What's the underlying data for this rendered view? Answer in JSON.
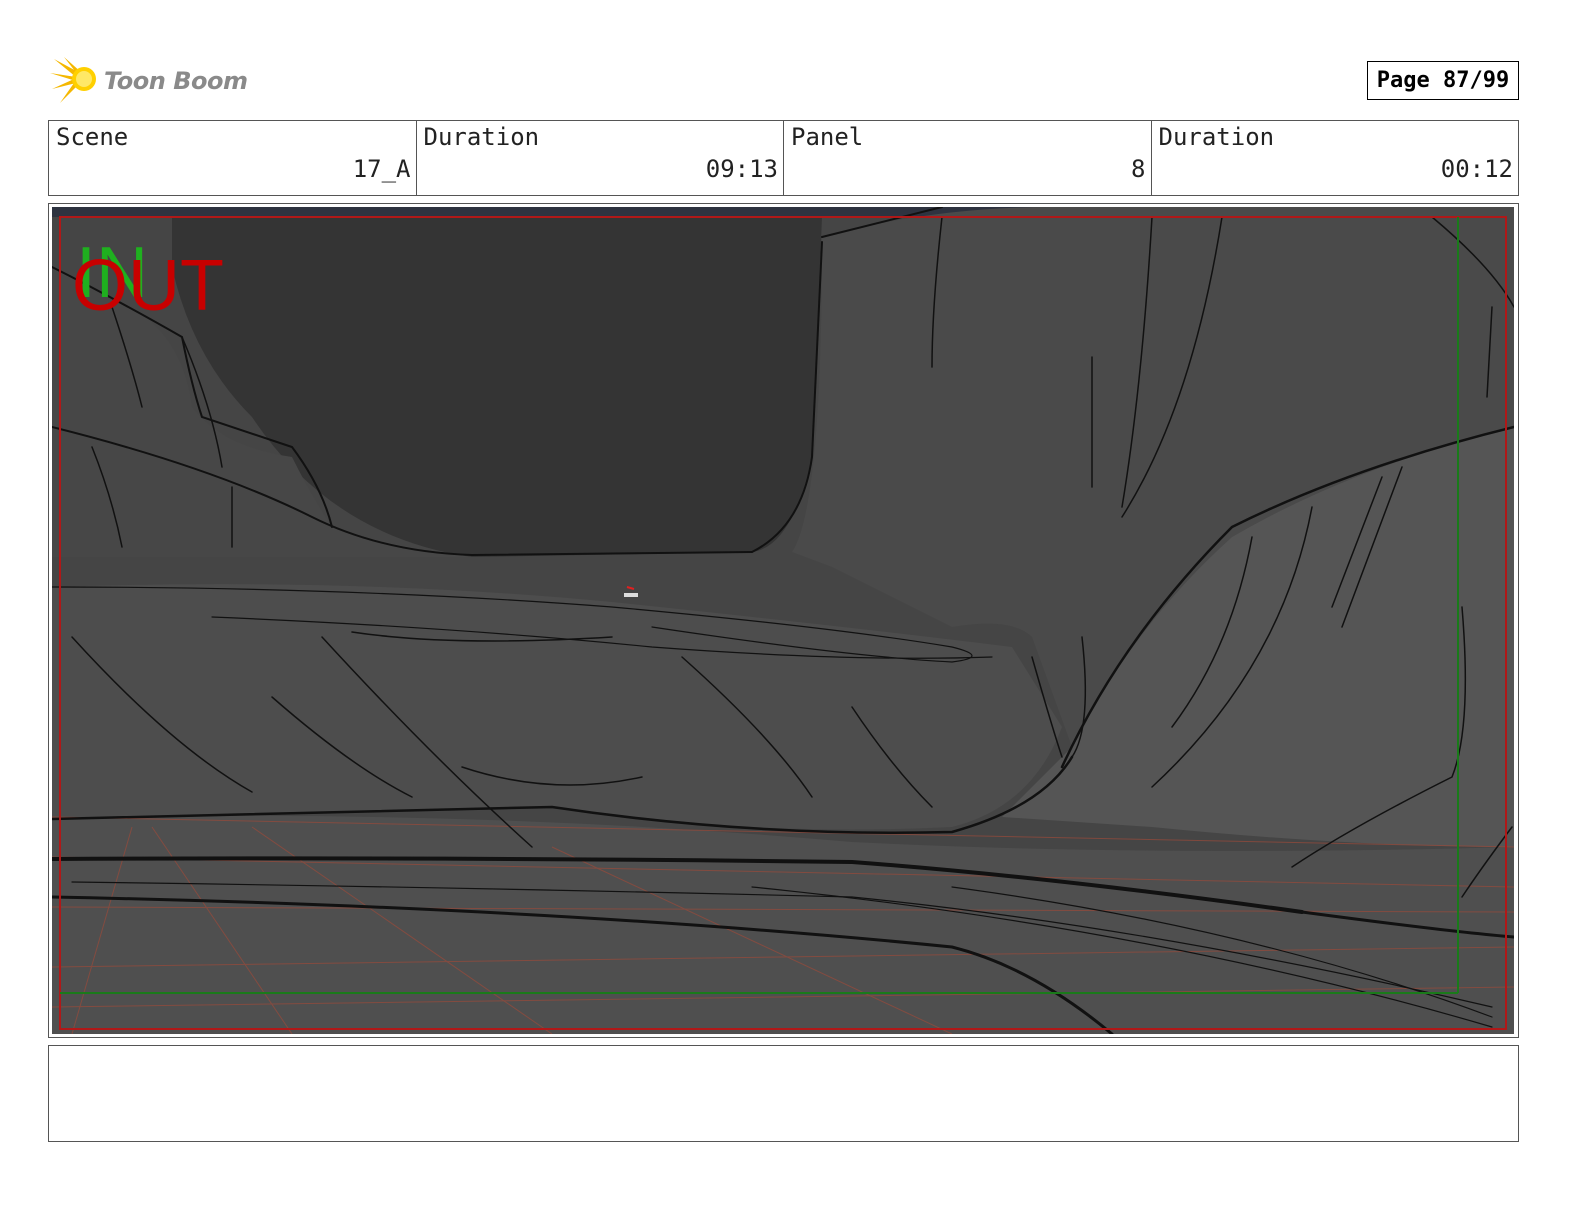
{
  "header": {
    "logo_text": "Toon Boom",
    "page_label": "Page 87/99"
  },
  "info": {
    "scene_label": "Scene",
    "scene_value": "17_A",
    "scene_duration_label": "Duration",
    "scene_duration_value": "09:13",
    "panel_label": "Panel",
    "panel_value": "8",
    "panel_duration_label": "Duration",
    "panel_duration_value": "00:12"
  },
  "frame": {
    "in_marker": "IN",
    "out_marker": "OUT",
    "colors": {
      "in_marker": "#1fb01f",
      "out_marker": "#c80000",
      "safe_frame": "#b01818",
      "title_safe": "#1a7a1a"
    }
  },
  "notes": {
    "text": ""
  }
}
